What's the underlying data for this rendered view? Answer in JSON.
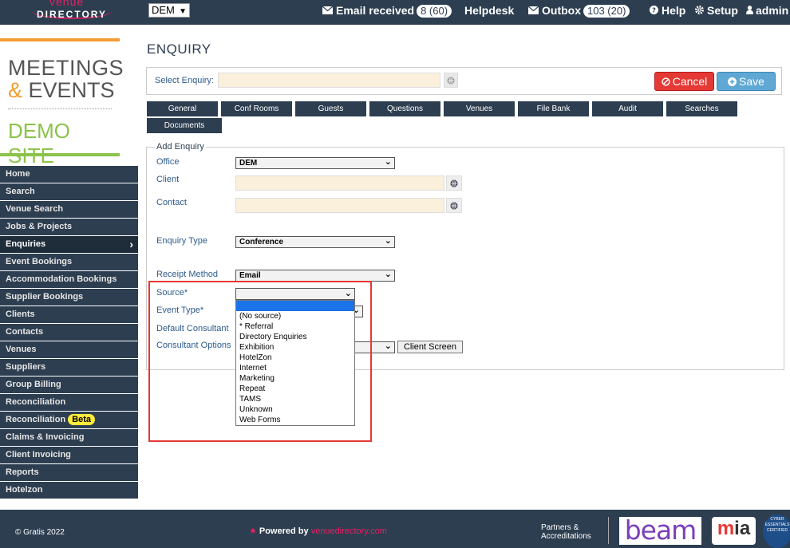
{
  "topbar": {
    "logo_line1": "venue",
    "logo_line2": "DIRECTORY",
    "office_value": "DEM",
    "email_label": "Email received",
    "email_count": "8 (60)",
    "helpdesk_label": "Helpdesk",
    "outbox_label": "Outbox",
    "outbox_count": "103 (20)",
    "help_label": "Help",
    "setup_label": "Setup",
    "admin_label": "admin"
  },
  "brand": {
    "line1": "MEETINGS",
    "amp": "&",
    "line2": "EVENTS",
    "line3": "DEMO SITE"
  },
  "sidebar": {
    "items": [
      {
        "label": "Home"
      },
      {
        "label": "Search"
      },
      {
        "label": "Venue Search"
      },
      {
        "label": "Jobs & Projects"
      },
      {
        "label": "Enquiries"
      },
      {
        "label": "Event Bookings"
      },
      {
        "label": "Accommodation Bookings"
      },
      {
        "label": "Supplier Bookings"
      },
      {
        "label": "Clients"
      },
      {
        "label": "Contacts"
      },
      {
        "label": "Venues"
      },
      {
        "label": "Suppliers"
      },
      {
        "label": "Group Billing"
      },
      {
        "label": "Reconciliation"
      },
      {
        "label": "Reconciliation",
        "badge": "Beta"
      },
      {
        "label": "Claims & Invoicing"
      },
      {
        "label": "Client Invoicing"
      },
      {
        "label": "Reports"
      },
      {
        "label": "Hotelzon"
      }
    ]
  },
  "main": {
    "title": "ENQUIRY",
    "select_enquiry_label": "Select Enquiry:",
    "cancel_label": "Cancel",
    "save_label": "Save",
    "tabs": [
      "General",
      "Conf Rooms",
      "Guests",
      "Questions",
      "Venues",
      "File Bank",
      "Audit",
      "Searches",
      "Documents"
    ],
    "legend": "Add Enquiry",
    "fields": {
      "office_label": "Office",
      "office_value": "DEM",
      "client_label": "Client",
      "contact_label": "Contact",
      "enquiry_type_label": "Enquiry Type",
      "enquiry_type_value": "Conference",
      "receipt_method_label": "Receipt Method",
      "receipt_method_value": "Email",
      "source_label": "Source*",
      "event_type_label": "Event Type*",
      "default_consultant_label": "Default Consultant",
      "consultant_options_label": "Consultant Options",
      "client_screen_label": "Client Screen"
    },
    "source_options": [
      "(No source)",
      "* Referral",
      "Directory Enquiries",
      "Exhibition",
      "HotelZon",
      "Internet",
      "Marketing",
      "Repeat",
      "TAMS",
      "Unknown",
      "Web Forms"
    ]
  },
  "footer": {
    "copyright": "© Gratis 2022",
    "powered_by": "Powered by",
    "powered_brand": "venuedirectory.com",
    "partners_line1": "Partners &",
    "partners_line2": "Accreditations",
    "beam": "beam",
    "mia_m": "m",
    "mia_rest": "ia",
    "cyber": "CYBER ESSENTIALS CERTIFIED"
  },
  "colors": {
    "navy": "#2d3e50",
    "cancel": "#e53935",
    "save": "#5fa8d3",
    "input_bg": "#faf0dc",
    "highlight": "#e53935",
    "dropdown_selected": "#1a73e8",
    "brand_orange": "#f39c33",
    "brand_green": "#8bc34a"
  }
}
